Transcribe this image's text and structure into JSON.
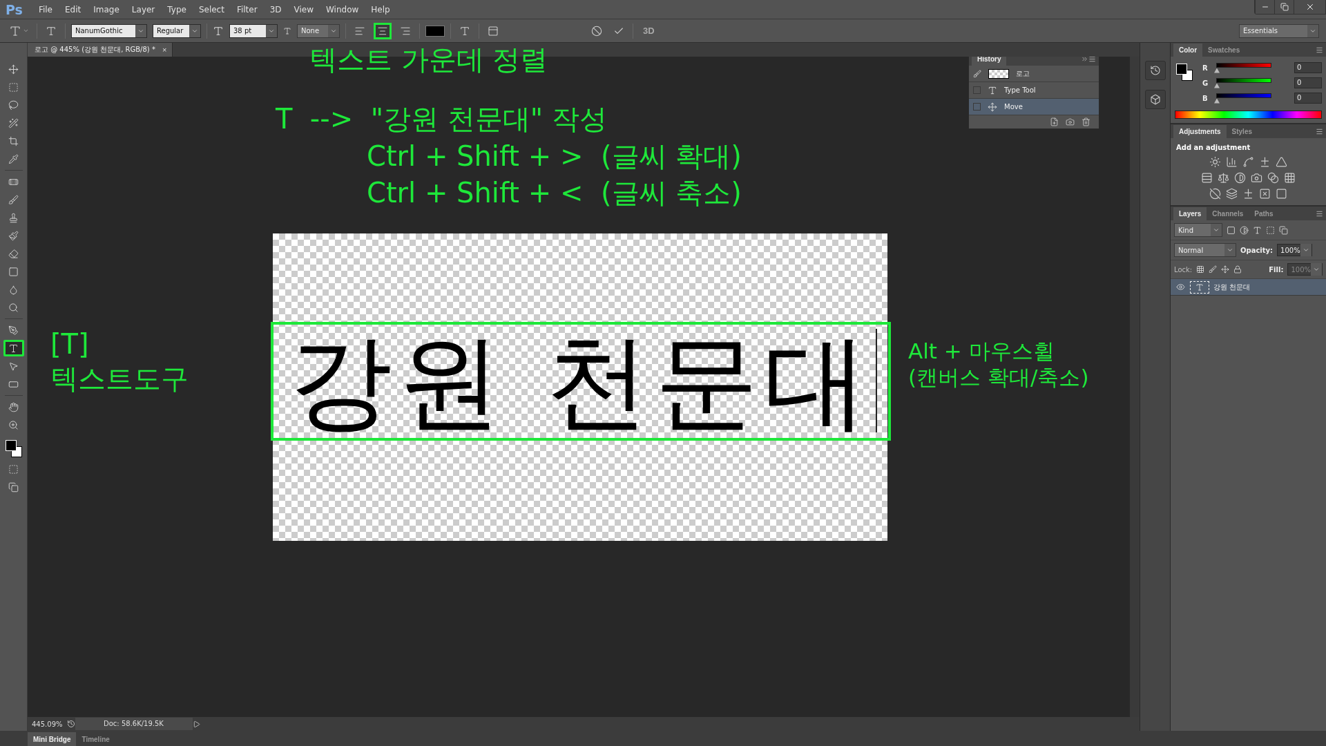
{
  "app": {
    "logo": "Ps"
  },
  "menu": [
    "File",
    "Edit",
    "Image",
    "Layer",
    "Type",
    "Select",
    "Filter",
    "3D",
    "View",
    "Window",
    "Help"
  ],
  "options_bar": {
    "font_family": "NanumGothic",
    "font_style": "Regular",
    "font_size": "38 pt",
    "antialiasing": "None",
    "alignment": [
      {
        "kind": "left",
        "selected": false,
        "annotated": false
      },
      {
        "kind": "center",
        "selected": true,
        "annotated": true
      },
      {
        "kind": "right",
        "selected": false,
        "annotated": false
      }
    ],
    "button_3d": "3D",
    "workspace": "Essentials"
  },
  "document_tab": {
    "title": "로고 @ 445% (강원 천문대, RGB/8) *",
    "close": "×"
  },
  "tools": [
    {
      "kind": "move",
      "selected": false,
      "annotated": false
    },
    {
      "kind": "marquee",
      "selected": false,
      "annotated": false
    },
    {
      "kind": "lasso",
      "selected": false,
      "annotated": false
    },
    {
      "kind": "quick-select",
      "selected": false,
      "annotated": false
    },
    {
      "kind": "crop",
      "selected": false,
      "annotated": false
    },
    {
      "kind": "eyedropper",
      "selected": false,
      "annotated": false
    },
    {
      "kind": "healing",
      "selected": false,
      "annotated": false
    },
    {
      "kind": "brush",
      "selected": false,
      "annotated": false
    },
    {
      "kind": "stamp",
      "selected": false,
      "annotated": false
    },
    {
      "kind": "history-brush",
      "selected": false,
      "annotated": false
    },
    {
      "kind": "eraser",
      "selected": false,
      "annotated": false
    },
    {
      "kind": "gradient",
      "selected": false,
      "annotated": false
    },
    {
      "kind": "blur",
      "selected": false,
      "annotated": false
    },
    {
      "kind": "dodge",
      "selected": false,
      "annotated": false
    },
    {
      "kind": "pen",
      "selected": false,
      "annotated": false
    },
    {
      "kind": "type",
      "selected": true,
      "annotated": true
    },
    {
      "kind": "path-select",
      "selected": false,
      "annotated": false
    },
    {
      "kind": "shape",
      "selected": false,
      "annotated": false
    },
    {
      "kind": "hand",
      "selected": false,
      "annotated": false
    },
    {
      "kind": "zoom",
      "selected": false,
      "annotated": false
    }
  ],
  "canvas": {
    "text": "강원 천문대",
    "text_box_annotated": true
  },
  "annotations": [
    {
      "text": "텍스트 가운데 정렬"
    },
    {
      "text": "T  -->  \"강원 천문대\" 작성"
    },
    {
      "text": "Ctrl + Shift + >  (글씨 확대)"
    },
    {
      "text": "Ctrl + Shift + <  (글씨 축소)"
    },
    {
      "text": "[T]"
    },
    {
      "text": "텍스트도구"
    },
    {
      "text": "Alt + 마우스휠"
    },
    {
      "text": "(캔버스 확대/축소)"
    }
  ],
  "history": {
    "title": "History",
    "snapshot": "로고",
    "items": [
      {
        "kind": "type",
        "label": "Type Tool",
        "selected": false
      },
      {
        "kind": "move",
        "label": "Move",
        "selected": true
      }
    ]
  },
  "color_panel": {
    "tabs": [
      {
        "label": "Color",
        "selected": true
      },
      {
        "label": "Swatches",
        "selected": false
      }
    ],
    "channels": [
      {
        "name": "R",
        "value": "0",
        "level": 0
      },
      {
        "name": "G",
        "value": "0",
        "level": 0
      },
      {
        "name": "B",
        "value": "0",
        "level": 0
      }
    ]
  },
  "adjustments": {
    "tabs": [
      {
        "label": "Adjustments",
        "selected": true
      },
      {
        "label": "Styles",
        "selected": false
      }
    ],
    "heading": "Add an adjustment"
  },
  "layers": {
    "tabs": [
      {
        "label": "Layers",
        "selected": true
      },
      {
        "label": "Channels",
        "selected": false
      },
      {
        "label": "Paths",
        "selected": false
      }
    ],
    "filter": "Kind",
    "blend_mode": "Normal",
    "opacity_label": "Opacity:",
    "opacity": "100%",
    "lock_label": "Lock:",
    "fill_label": "Fill:",
    "fill": "100%",
    "items": [
      {
        "kind": "text",
        "name": "강원 천문대",
        "visible": true,
        "selected": true
      }
    ]
  },
  "status_bar": {
    "zoom": "445.09%",
    "doc": "Doc: 58.6K/19.5K"
  },
  "bottom_tabs": [
    {
      "label": "Mini Bridge",
      "selected": true
    },
    {
      "label": "Timeline",
      "selected": false
    }
  ]
}
